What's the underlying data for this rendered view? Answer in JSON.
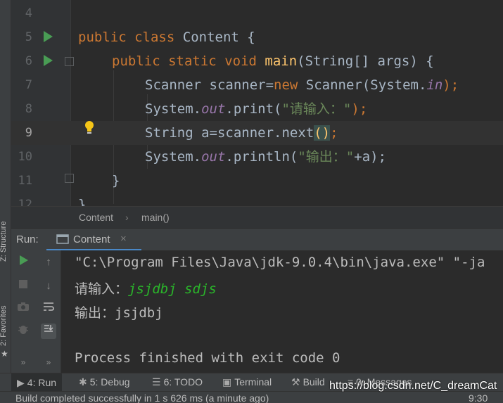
{
  "editor": {
    "lines": [
      {
        "num": "4"
      },
      {
        "num": "5",
        "tokens": {
          "kw1": "public",
          "kw2": "class",
          "name": "Content",
          "rest": " {"
        }
      },
      {
        "num": "6",
        "tokens": {
          "kw1": "public",
          "kw2": "static",
          "kw3": "void",
          "fn": "main",
          "rest": "(String[] args) {"
        }
      },
      {
        "num": "7",
        "tokens": {
          "a": "Scanner scanner=",
          "kw": "new",
          "b": " Scanner(System.",
          "fld": "in",
          "c": ");"
        }
      },
      {
        "num": "8",
        "tokens": {
          "a": "System.",
          "fld": "out",
          "b": ".print(",
          "str": "\"请输入：\"",
          "c": ");"
        }
      },
      {
        "num": "9",
        "tokens": {
          "a": "String a=scanner.",
          "b": "next",
          "p": "()",
          "c": ";"
        }
      },
      {
        "num": "10",
        "tokens": {
          "a": "System.",
          "fld": "out",
          "b": ".println(",
          "str": "\"输出：\"",
          "c": "+a);"
        }
      },
      {
        "num": "11",
        "tokens": {
          "a": "}"
        }
      },
      {
        "num": "12",
        "tokens": {
          "a": "}"
        }
      }
    ]
  },
  "breadcrumb": {
    "class": "Content",
    "method": "main()"
  },
  "run_panel": {
    "label": "Run:",
    "tab_title": "Content",
    "tab_close": "×"
  },
  "console": {
    "cmd": "\"C:\\Program Files\\Java\\jdk-9.0.4\\bin\\java.exe\" \"-ja",
    "prompt": "请输入：",
    "input": "jsjdbj sdjs",
    "output": "输出：jsjdbj",
    "finished": "Process finished with exit code 0"
  },
  "left_strip": {
    "structure": "Z: Structure",
    "favorites": "2: Favorites"
  },
  "toolbar": {
    "run": "4: Run",
    "debug": "5: Debug",
    "todo": "6: TODO",
    "terminal": "Terminal",
    "build": "Build",
    "messages": "0: Messages"
  },
  "status": {
    "text": "Build completed successfully in 1 s 626 ms (a minute ago)",
    "position": "9:30"
  },
  "watermark": "https://blog.csdn.net/C_dreamCat",
  "colors": {
    "run_green": "#499c54",
    "keyword": "#cc7832",
    "string": "#6a8759",
    "field": "#9876aa",
    "method": "#ffc66d",
    "console_input": "#2ab62a"
  }
}
